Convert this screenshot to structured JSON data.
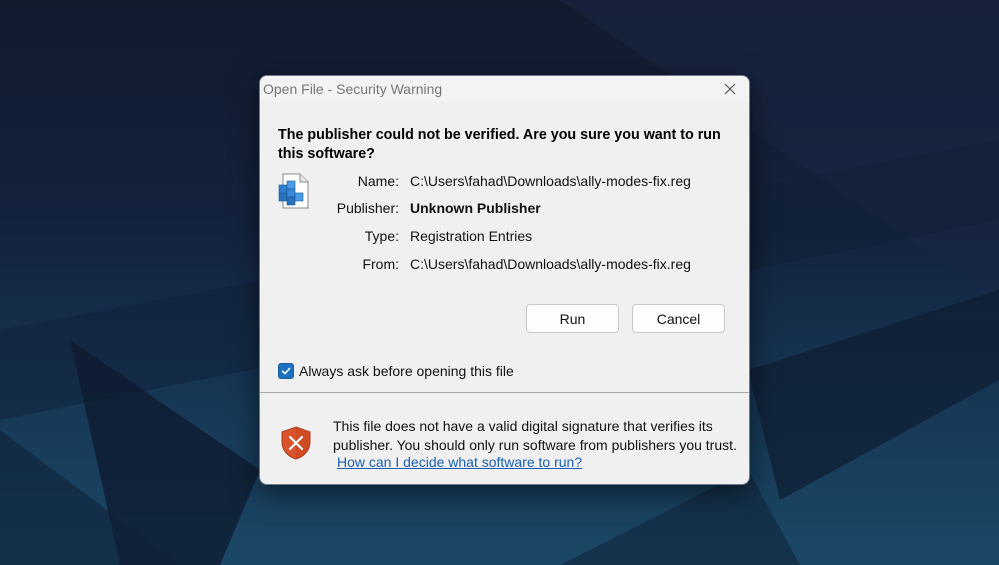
{
  "dialog": {
    "title": "Open File - Security Warning",
    "heading": "The publisher could not be verified.  Are you sure you want to run this software?",
    "fields": [
      {
        "label": "Name:",
        "value": "C:\\Users\\fahad\\Downloads\\ally-modes-fix.reg",
        "bold": false
      },
      {
        "label": "Publisher:",
        "value": "Unknown Publisher",
        "bold": true
      },
      {
        "label": "Type:",
        "value": "Registration Entries",
        "bold": false
      },
      {
        "label": "From:",
        "value": "C:\\Users\\fahad\\Downloads\\ally-modes-fix.reg",
        "bold": false
      }
    ],
    "run_label": "Run",
    "cancel_label": "Cancel",
    "checkbox_label": "Always ask before opening this file",
    "checkbox_checked": true,
    "warning_text": "This file does not have a valid digital signature that verifies its publisher.  You should only run software from publishers you trust.",
    "help_link": "How can I decide what software to run?"
  },
  "icons": {
    "file": "registry-file-icon",
    "warning": "shield-warning-icon",
    "close": "close-icon",
    "check": "checkmark-icon"
  },
  "colors": {
    "accent": "#1f6fbf",
    "link": "#1a5fb4",
    "shield": "#d9532c"
  }
}
